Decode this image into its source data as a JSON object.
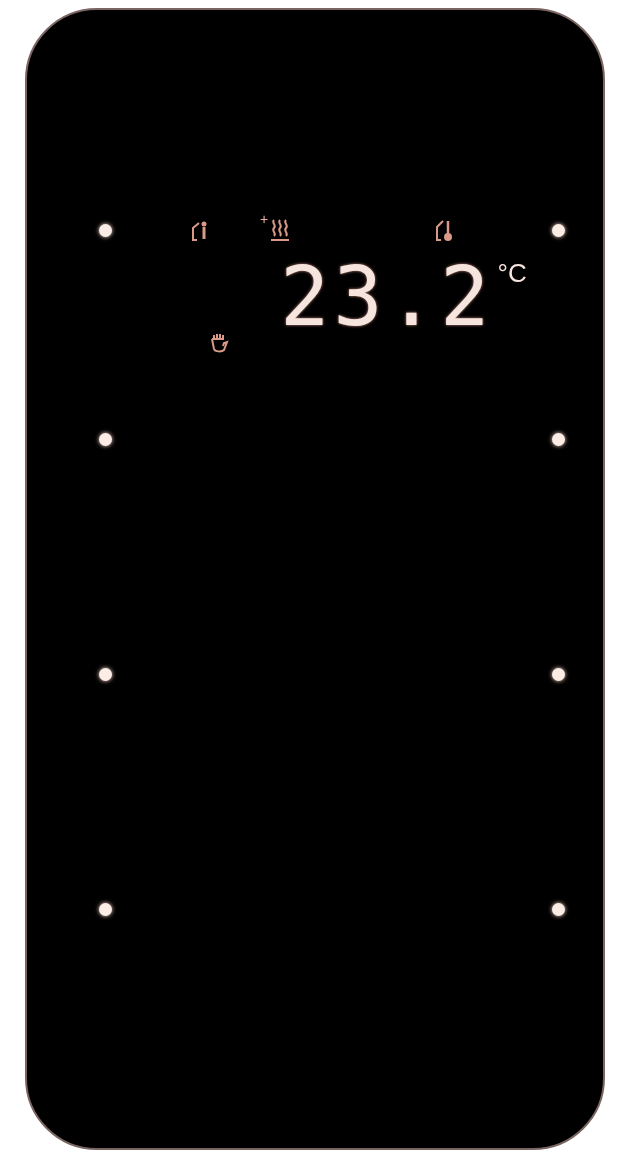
{
  "display": {
    "boost_sign": "+",
    "temperature": "23.2",
    "unit": "°C"
  }
}
